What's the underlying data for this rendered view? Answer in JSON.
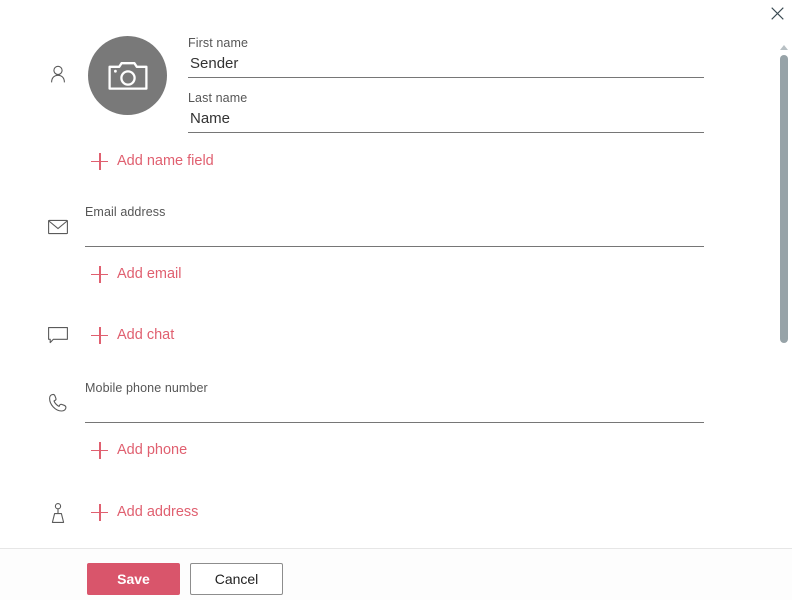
{
  "window": {
    "close_label": "Close",
    "close_icon": "close-icon"
  },
  "scrollbar": {
    "up_icon": "chevron-up-icon",
    "down_icon": "chevron-down-icon",
    "thumb_label": "scroll-thumb"
  },
  "avatar": {
    "icon": "camera-icon",
    "alt": "Add photo"
  },
  "sections": {
    "name": {
      "icon": "person-icon",
      "first_name": {
        "label": "First name",
        "value": "Sender",
        "placeholder": ""
      },
      "last_name": {
        "label": "Last name",
        "value": "Name",
        "placeholder": ""
      },
      "add_link": "Add name field"
    },
    "email": {
      "icon": "envelope-icon",
      "field": {
        "label": "Email address",
        "value": "",
        "placeholder": ""
      },
      "add_link": "Add email"
    },
    "chat": {
      "icon": "chat-bubble-icon",
      "add_link": "Add chat"
    },
    "phone": {
      "icon": "phone-icon",
      "field": {
        "label": "Mobile phone number",
        "value": "",
        "placeholder": ""
      },
      "add_link": "Add phone"
    },
    "address": {
      "icon": "address-marker-icon",
      "add_link": "Add address"
    }
  },
  "footer": {
    "save_label": "Save",
    "cancel_label": "Cancel"
  },
  "colors": {
    "accent_red": "#e06070",
    "save_button": "#d9556b",
    "avatar_gray": "#797979",
    "field_underline": "#767676",
    "scrollbar_thumb": "#97a3a8"
  }
}
